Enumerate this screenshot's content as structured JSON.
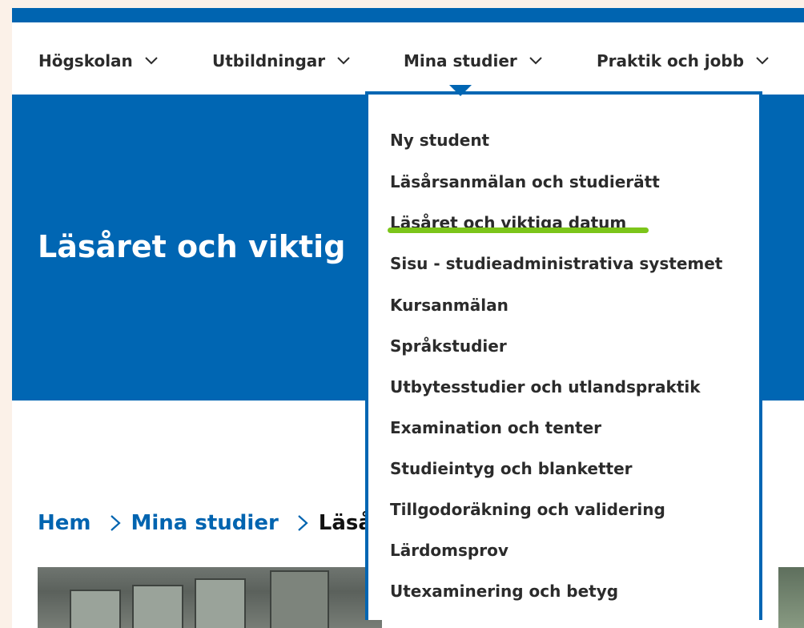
{
  "nav": {
    "items": [
      {
        "label": "Högskolan"
      },
      {
        "label": "Utbildningar"
      },
      {
        "label": "Mina studier"
      },
      {
        "label": "Praktik och jobb"
      }
    ]
  },
  "hero": {
    "title": "Läsåret och viktig"
  },
  "dropdown": {
    "items": [
      {
        "label": "Ny student"
      },
      {
        "label": "Läsårsanmälan och studierätt"
      },
      {
        "label": "Läsåret och viktiga datum"
      },
      {
        "label": "Sisu - studieadministrativa systemet"
      },
      {
        "label": "Kursanmälan"
      },
      {
        "label": "Språkstudier"
      },
      {
        "label": "Utbytesstudier och utlandspraktik"
      },
      {
        "label": "Examination och tenter"
      },
      {
        "label": "Studieintyg och blanketter"
      },
      {
        "label": "Tillgodoräkning och validering"
      },
      {
        "label": "Lärdomsprov"
      },
      {
        "label": "Utexaminering och betyg"
      }
    ],
    "highlighted_index": 2
  },
  "breadcrumb": {
    "home": "Hem",
    "section": "Mina studier",
    "current": "Läså"
  },
  "colors": {
    "brand_blue": "#0066b3",
    "highlight_green": "#7cc51a",
    "page_background": "#fbf1e8"
  }
}
